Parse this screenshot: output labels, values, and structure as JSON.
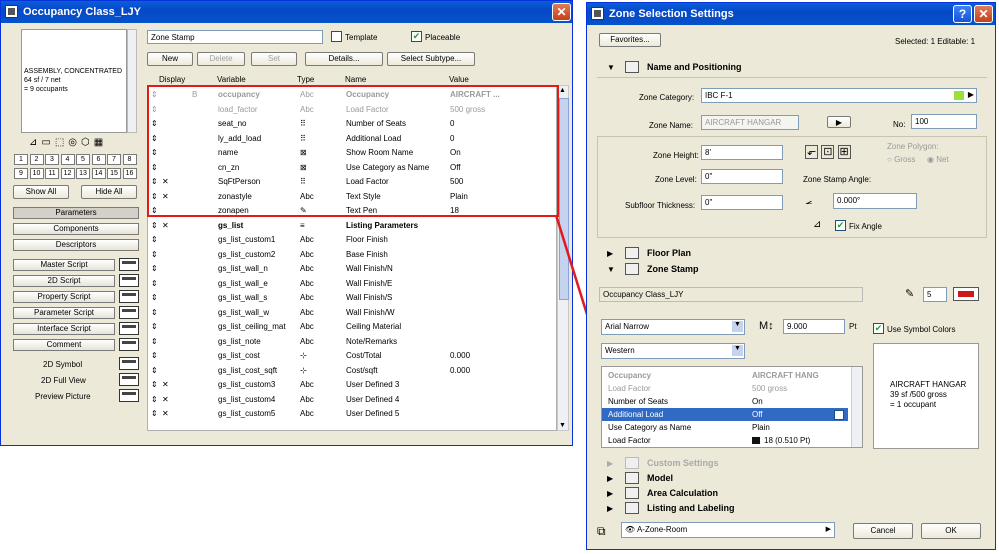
{
  "left_window": {
    "title": "Occupancy Class_LJY",
    "close_label": "✕",
    "preview_text": [
      "ASSEMBLY, CONCENTRATED",
      "64 sf / 7 net",
      "= 9 occupants"
    ],
    "top_field": "Zone Stamp",
    "template_label": "Template",
    "placeable_label": "Placeable",
    "placeable_checked": true,
    "template_checked": false,
    "buttons": {
      "new": "New",
      "delete": "Delete",
      "set": "Set",
      "details": "Details...",
      "select_subtype": "Select Subtype..."
    },
    "numbers_row1": [
      "1",
      "2",
      "3",
      "4",
      "5",
      "6",
      "7",
      "8"
    ],
    "numbers_row2": [
      "9",
      "10",
      "11",
      "12",
      "13",
      "14",
      "15",
      "16"
    ],
    "show_all": "Show All",
    "hide_all": "Hide All",
    "nav": [
      "Parameters",
      "Components",
      "Descriptors"
    ],
    "scripts": [
      "Master Script",
      "2D Script",
      "Property Script",
      "Parameter Script",
      "Interface Script",
      "Comment"
    ],
    "views": [
      "2D Symbol",
      "2D Full View",
      "Preview Picture"
    ],
    "columns": {
      "display": "Display",
      "variable": "Variable",
      "type": "Type",
      "name": "Name",
      "value": "Value"
    },
    "rows": [
      {
        "mark": "B",
        "variable": "occupancy",
        "type": "Abc",
        "name": "Occupancy",
        "value": "AIRCRAFT ...",
        "bold": true,
        "grey": true,
        "x": false
      },
      {
        "mark": "",
        "variable": "load_factor",
        "type": "Abc",
        "name": "Load Factor",
        "value": "500 gross",
        "bold": false,
        "grey": true,
        "x": false
      },
      {
        "mark": "",
        "variable": "seat_no",
        "type": "⠿",
        "name": "Number of Seats",
        "value": "0",
        "bold": false,
        "grey": false,
        "x": false
      },
      {
        "mark": "",
        "variable": "ly_add_load",
        "type": "⠿",
        "name": "Additional Load",
        "value": "0",
        "bold": false,
        "grey": false,
        "x": false
      },
      {
        "mark": "",
        "variable": "name",
        "type": "⊠",
        "name": "Show Room Name",
        "value": "On",
        "bold": false,
        "grey": false,
        "x": false
      },
      {
        "mark": "",
        "variable": "cn_zn",
        "type": "⊠",
        "name": "Use Category as Name",
        "value": "Off",
        "bold": false,
        "grey": false,
        "x": false
      },
      {
        "mark": "",
        "variable": "SqFtPerson",
        "type": "⠿",
        "name": "Load Factor",
        "value": "500",
        "bold": false,
        "grey": false,
        "x": true
      },
      {
        "mark": "",
        "variable": "zonastyle",
        "type": "Abc",
        "name": "Text Style",
        "value": "Plain",
        "bold": false,
        "grey": false,
        "x": true
      },
      {
        "mark": "",
        "variable": "zonapen",
        "type": "✎",
        "name": "Text Pen",
        "value": "18",
        "bold": false,
        "grey": false,
        "x": false
      },
      {
        "mark": "",
        "variable": "gs_list",
        "type": "≡",
        "name": "Listing Parameters",
        "value": "",
        "bold": true,
        "grey": false,
        "x": true
      },
      {
        "mark": "",
        "variable": "gs_list_custom1",
        "type": "Abc",
        "name": "Floor Finish",
        "value": "",
        "bold": false,
        "grey": false,
        "x": false
      },
      {
        "mark": "",
        "variable": "gs_list_custom2",
        "type": "Abc",
        "name": "Base Finish",
        "value": "",
        "bold": false,
        "grey": false,
        "x": false
      },
      {
        "mark": "",
        "variable": "gs_list_wall_n",
        "type": "Abc",
        "name": "Wall Finish/N",
        "value": "",
        "bold": false,
        "grey": false,
        "x": false
      },
      {
        "mark": "",
        "variable": "gs_list_wall_e",
        "type": "Abc",
        "name": "Wall Finish/E",
        "value": "",
        "bold": false,
        "grey": false,
        "x": false
      },
      {
        "mark": "",
        "variable": "gs_list_wall_s",
        "type": "Abc",
        "name": "Wall Finish/S",
        "value": "",
        "bold": false,
        "grey": false,
        "x": false
      },
      {
        "mark": "",
        "variable": "gs_list_wall_w",
        "type": "Abc",
        "name": "Wall Finish/W",
        "value": "",
        "bold": false,
        "grey": false,
        "x": false
      },
      {
        "mark": "",
        "variable": "gs_list_ceiling_mat",
        "type": "Abc",
        "name": "Ceiling Material",
        "value": "",
        "bold": false,
        "grey": false,
        "x": false
      },
      {
        "mark": "",
        "variable": "gs_list_note",
        "type": "Abc",
        "name": "Note/Remarks",
        "value": "",
        "bold": false,
        "grey": false,
        "x": false
      },
      {
        "mark": "",
        "variable": "gs_list_cost",
        "type": "⊹",
        "name": "Cost/Total",
        "value": "0.000",
        "bold": false,
        "grey": false,
        "x": false
      },
      {
        "mark": "",
        "variable": "gs_list_cost_sqft",
        "type": "⊹",
        "name": "Cost/sqft",
        "value": "0.000",
        "bold": false,
        "grey": false,
        "x": false
      },
      {
        "mark": "",
        "variable": "gs_list_custom3",
        "type": "Abc",
        "name": "User Defined 3",
        "value": "",
        "bold": false,
        "grey": false,
        "x": true
      },
      {
        "mark": "",
        "variable": "gs_list_custom4",
        "type": "Abc",
        "name": "User Defined 4",
        "value": "",
        "bold": false,
        "grey": false,
        "x": true
      },
      {
        "mark": "",
        "variable": "gs_list_custom5",
        "type": "Abc",
        "name": "User Defined 5",
        "value": "",
        "bold": false,
        "grey": false,
        "x": true
      }
    ]
  },
  "right_window": {
    "title": "Zone Selection Settings",
    "help_label": "?",
    "close_label": "✕",
    "favorites": "Favorites...",
    "selected_info": "Selected: 1 Editable: 1",
    "sections": {
      "name_pos": "Name and Positioning",
      "floor_plan": "Floor Plan",
      "zone_stamp": "Zone Stamp",
      "custom": "Custom Settings",
      "model": "Model",
      "area": "Area Calculation",
      "listing": "Listing and Labeling"
    },
    "zone_category_label": "Zone Category:",
    "zone_category_value": "IBC  F-1",
    "zone_name_label": "Zone Name:",
    "zone_name_value": "AIRCRAFT HANGAR",
    "no_label": "No:",
    "no_value": "100",
    "zone_height_label": "Zone Height:",
    "zone_height_value": "8'",
    "zone_level_label": "Zone Level:",
    "zone_level_value": "0\"",
    "subfloor_label": "Subfloor Thickness:",
    "subfloor_value": "0\"",
    "polygon_label": "Zone Polygon:",
    "gross_label": "Gross",
    "net_label": "Net",
    "stamp_angle_label": "Zone Stamp Angle:",
    "angle_value": "0.000°",
    "fix_angle_label": "Fix Angle",
    "stamp_name": "Occupancy Class_LJY",
    "pen_value": "5",
    "font_value": "Arial Narrow",
    "size_value": "9.000",
    "size_unit": "Pt",
    "use_symbol_colors": "Use Symbol Colors",
    "script_value": "Western",
    "preview_text": [
      "AIRCRAFT HANGAR",
      "39 sf /500 gross",
      "= 1 occupant"
    ],
    "params": [
      {
        "name": "Occupancy",
        "value": "AIRCRAFT HANG",
        "state": "grey-bold"
      },
      {
        "name": "Load Factor",
        "value": "500 gross",
        "state": "grey"
      },
      {
        "name": "Number of Seats",
        "value": "On",
        "state": "normal"
      },
      {
        "name": "Additional Load",
        "value": "Off",
        "state": "selected"
      },
      {
        "name": "Use Category as Name",
        "value": "Plain",
        "state": "normal"
      },
      {
        "name": "Load Factor",
        "value": "18 (0.510 Pt)",
        "state": "pen"
      }
    ],
    "layer_value": "A-Zone-Room",
    "cancel": "Cancel",
    "ok": "OK",
    "accent_green": "#99e03a",
    "accent_red": "#cc1a1a"
  }
}
